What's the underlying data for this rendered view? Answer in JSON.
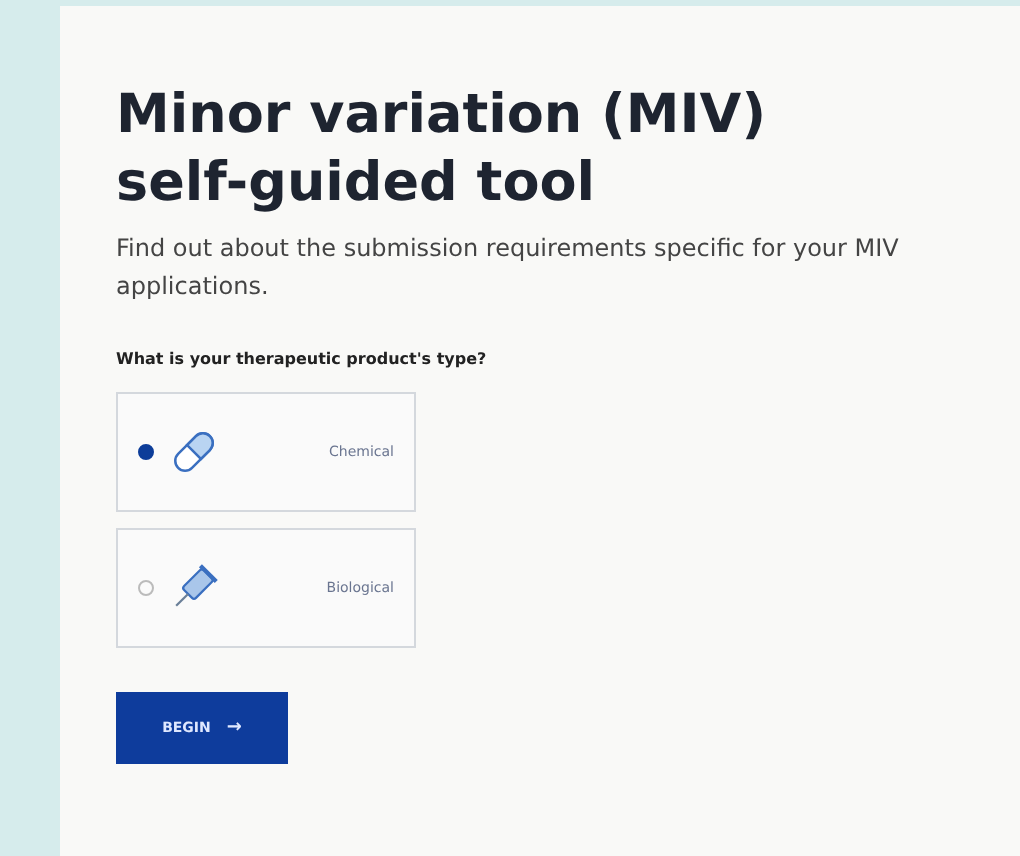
{
  "title": "Minor variation (MIV) self-guided tool",
  "description": "Find out about the submission requirements specific for your MIV applications.",
  "question": "What is your therapeutic product's type?",
  "options": [
    {
      "label": "Chemical",
      "kind": "pill",
      "selected": true
    },
    {
      "label": "Biological",
      "kind": "syringe",
      "selected": false
    }
  ],
  "button": {
    "label": "BEGIN",
    "arrow": "→"
  }
}
